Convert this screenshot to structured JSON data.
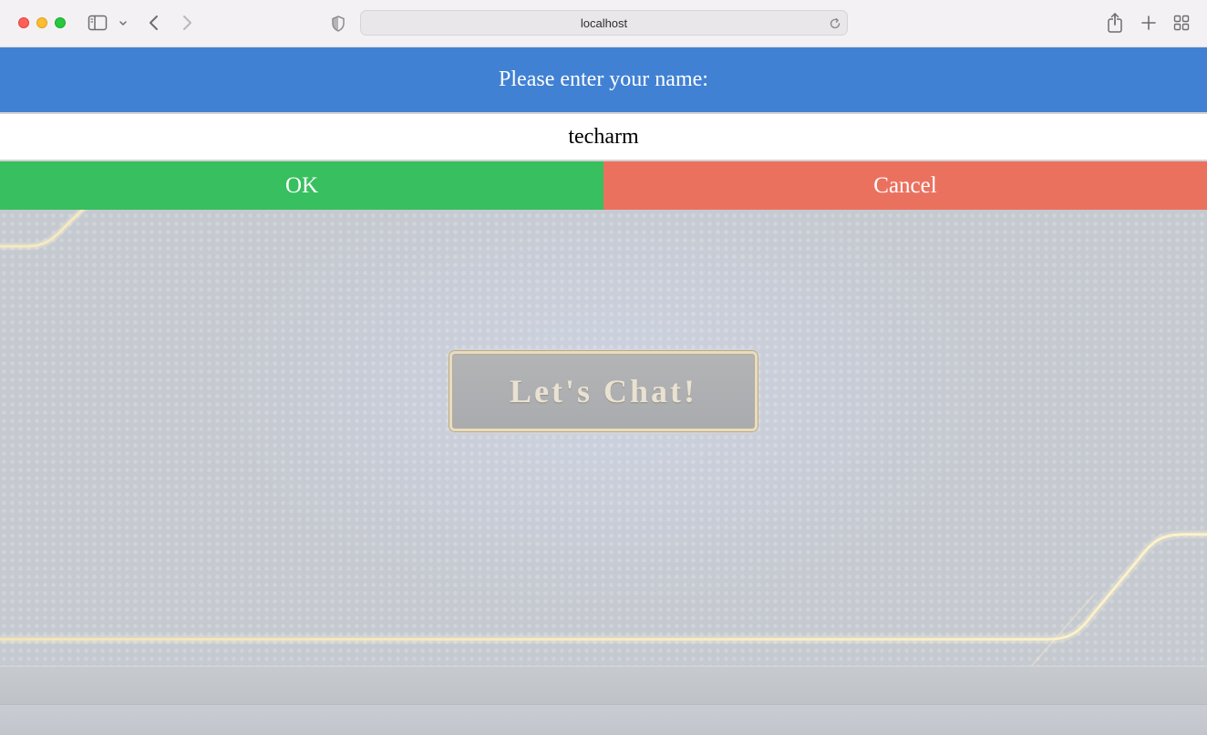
{
  "browser": {
    "url": "localhost"
  },
  "prompt": {
    "title": "Please enter your name:",
    "input_value": "techarm",
    "ok_label": "OK",
    "cancel_label": "Cancel"
  },
  "main": {
    "chat_button_label": "Let's Chat!"
  },
  "colors": {
    "header_blue": "#4181d3",
    "ok_green": "#38bf5f",
    "cancel_red": "#eb715f",
    "accent_gold": "#f5e3a8"
  },
  "icons": {
    "toolbar": [
      "sidebar-icon",
      "chevron-down-icon",
      "back-arrow-icon",
      "forward-arrow-icon",
      "shield-icon",
      "reload-icon",
      "share-icon",
      "plus-icon",
      "tab-grid-icon"
    ]
  }
}
